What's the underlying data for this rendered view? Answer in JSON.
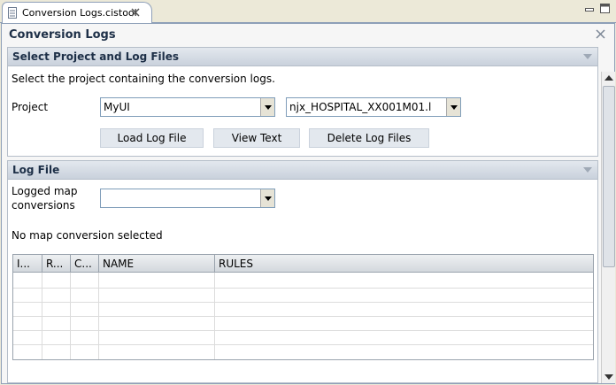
{
  "tab": {
    "label": "Conversion Logs.cistool"
  },
  "form": {
    "title": "Conversion Logs"
  },
  "select_section": {
    "title": "Select Project and Log Files",
    "description": "Select the project containing the conversion logs.",
    "project_label": "Project",
    "project_value": "MyUI",
    "log_file_value": "njx_HOSPITAL_XX001M01.l",
    "buttons": {
      "load": "Load Log File",
      "view": "View Text",
      "delete": "Delete Log Files"
    }
  },
  "log_section": {
    "title": "Log File",
    "logged_label_line1": "Logged map",
    "logged_label_line2": "conversions",
    "logged_value": "",
    "status_text": "No map conversion selected",
    "table": {
      "columns": [
        "I...",
        "R...",
        "C...",
        "NAME",
        "RULES"
      ],
      "rows": []
    }
  },
  "icons": {
    "tab_icon": "file-icon",
    "tab_close": "close-icon",
    "form_close": "close-icon"
  }
}
